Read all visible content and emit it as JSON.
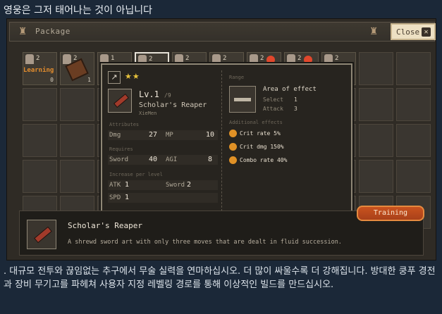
{
  "page_heading": "영웅은 그저 태어나는 것이 아닙니다",
  "topbar": {
    "title": "Package",
    "close_label": "Close"
  },
  "slots_row1": [
    {
      "count": "2",
      "badge": false
    },
    {
      "count": "2",
      "badge": false
    },
    {
      "count": "1",
      "badge": false
    },
    {
      "count": "2",
      "badge": false
    },
    {
      "count": "2",
      "badge": false
    },
    {
      "count": "2",
      "badge": false
    },
    {
      "count": "2",
      "badge": true
    },
    {
      "count": "2",
      "badge": true
    },
    {
      "count": "2",
      "badge": false
    }
  ],
  "slot1": {
    "learning": "Learning",
    "count": "0"
  },
  "slot2": {
    "count": "1"
  },
  "tooltip": {
    "stars": "★★",
    "level": "Lv.1",
    "level_max": "/9",
    "name": "Scholar's Reaper",
    "source": "XieMen",
    "attributes_label": "Attributes",
    "dmg_label": "Dmg",
    "dmg_value": "27",
    "mp_label": "MP",
    "mp_value": "10",
    "requires_label": "Requires",
    "sword_label": "Sword",
    "sword_value": "40",
    "agi_label": "AGI",
    "agi_value": "8",
    "increase_label": "Increase per level",
    "atk_label": "ATK",
    "atk_value": "1",
    "sword_inc_label": "Sword",
    "sword_inc_value": "2",
    "spd_label": "SPD",
    "spd_value": "1",
    "range_label": "Range",
    "aoe_title": "Area of effect",
    "select_label": "Select",
    "select_value": "1",
    "attack_label": "Attack",
    "attack_value": "3",
    "effects_label": "Additional effects",
    "effects": [
      "Crit rate 5%",
      "Crit dmg 150%",
      "Combo rate 40%"
    ]
  },
  "bottom": {
    "name": "Scholar's Reaper",
    "description": "A shrewd sword art with only three moves that are dealt in fluid succession."
  },
  "training_label": "Training",
  "footer": ". 대규모 전투와 끊임없는 추구에서 무술 실력을 연마하십시오. 더 많이 싸울수록 더 강해집니다. 방대한 쿵푸 경전과 장비 무기고를 파헤쳐 사용자 지정 레벨링 경로를 통해 이상적인 빌드를 만드십시오."
}
